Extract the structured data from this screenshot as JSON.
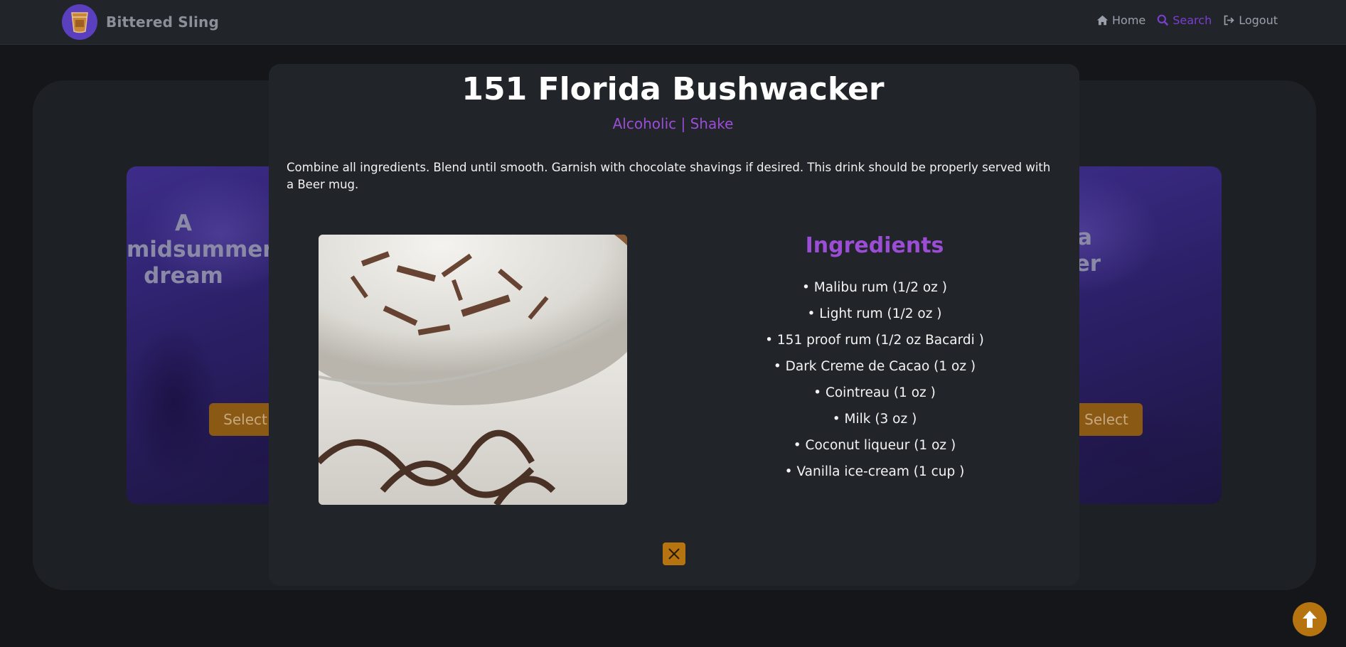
{
  "navbar": {
    "brand_name": "Bittered Sling",
    "links": [
      {
        "label": "Home",
        "icon": "home-icon",
        "active": false
      },
      {
        "label": "Search",
        "icon": "search-icon",
        "active": true
      },
      {
        "label": "Logout",
        "icon": "logout-icon",
        "active": false
      }
    ]
  },
  "background_cards": {
    "left": {
      "title": "A midsummer dream",
      "select_label": "Select"
    },
    "right": {
      "title": "Florida hwacker",
      "select_label": "Select"
    }
  },
  "modal": {
    "title": "151 Florida Bushwacker",
    "subtitle": "Alcoholic | Shake",
    "description": "Combine all ingredients. Blend until smooth. Garnish with chocolate shavings if desired. This drink should be properly served with a Beer mug.",
    "ingredients_heading": "Ingredients",
    "ingredients": [
      "• Malibu rum (1/2 oz )",
      "• Light rum (1/2 oz )",
      "• 151 proof rum (1/2 oz Bacardi )",
      "• Dark Creme de Cacao (1 oz )",
      "• Cointreau (1 oz )",
      "• Milk (3 oz )",
      "• Coconut liqueur (1 oz )",
      "• Vanilla ice-cream (1 cup )"
    ],
    "close_icon": "close-icon"
  },
  "colors": {
    "accent_purple": "#9b4dd6",
    "button_orange": "#b5740f",
    "nav_bg": "#212429",
    "page_bg": "#14161a"
  }
}
